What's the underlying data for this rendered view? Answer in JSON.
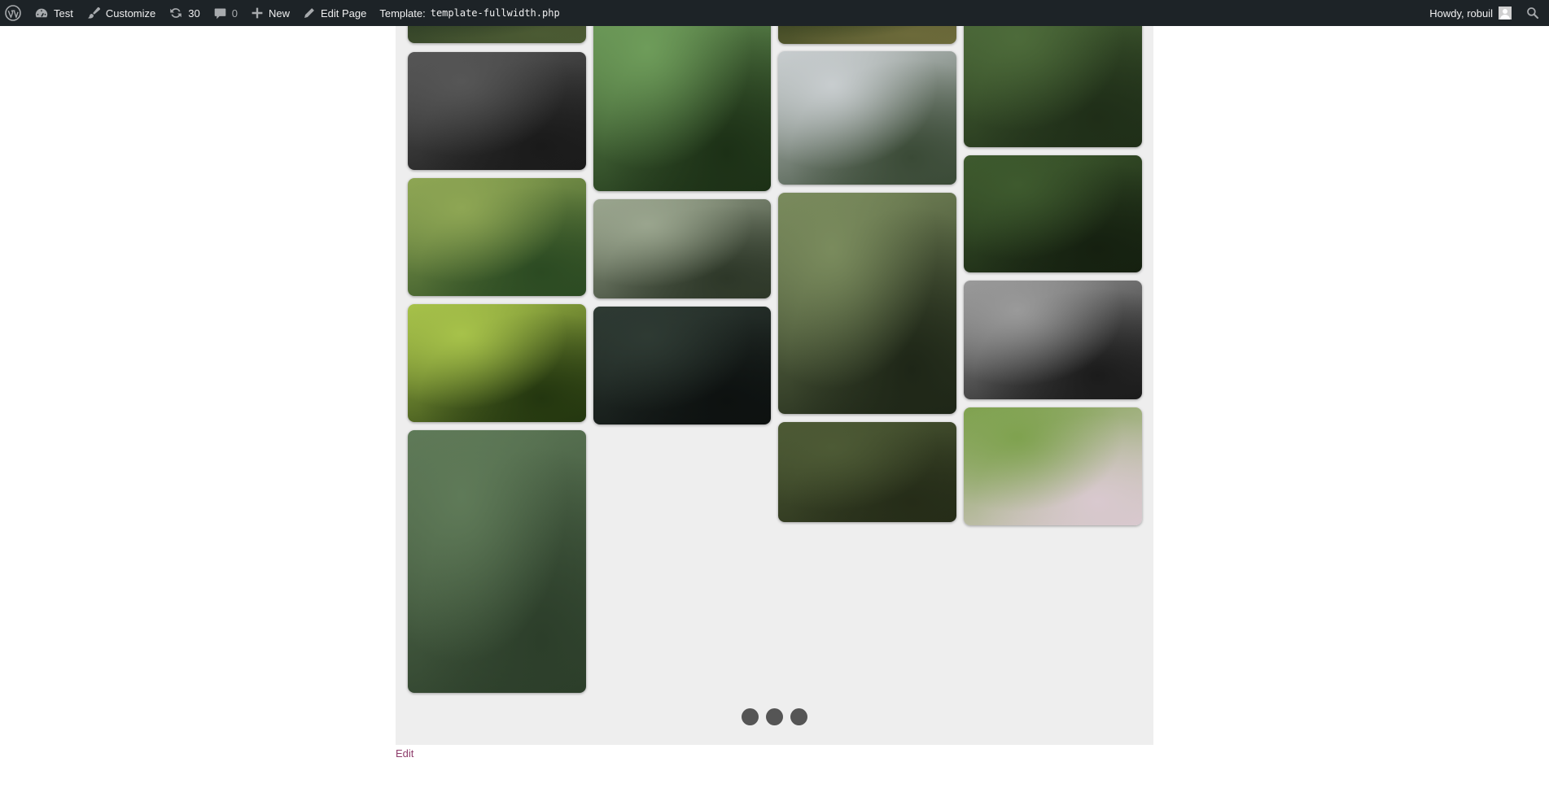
{
  "adminbar": {
    "site_name": "Test",
    "customize_label": "Customize",
    "updates_count": "30",
    "comments_count": "0",
    "new_label": "New",
    "edit_page_label": "Edit Page",
    "template_label": "Template:",
    "template_file": "template-fullwidth.php",
    "greeting": "Howdy, robuil"
  },
  "gallery": {
    "photos": [
      {
        "name": "photo-forest-top-strip-1",
        "colors": [
          "#2f3f26",
          "#4b5a33"
        ]
      },
      {
        "name": "photo-misty-dark-forest",
        "colors": [
          "#565656",
          "#1a1a1a"
        ]
      },
      {
        "name": "photo-tall-trees-green",
        "colors": [
          "#8ea654",
          "#2b4a22"
        ]
      },
      {
        "name": "photo-bright-canopy",
        "colors": [
          "#a7c24a",
          "#23360f"
        ]
      },
      {
        "name": "photo-hiker-on-trail",
        "colors": [
          "#5f7a58",
          "#2c3e2a"
        ]
      },
      {
        "name": "photo-forest-path",
        "colors": [
          "#6e9c5a",
          "#1c3016"
        ]
      },
      {
        "name": "photo-tree-canopy-sky",
        "colors": [
          "#9aa58e",
          "#2d3728"
        ]
      },
      {
        "name": "photo-dark-fern",
        "colors": [
          "#2e3a33",
          "#0d1110"
        ]
      },
      {
        "name": "photo-forest-top-strip-3",
        "colors": [
          "#3b4522",
          "#6c6a3a"
        ]
      },
      {
        "name": "photo-misty-valley",
        "colors": [
          "#c8cdcf",
          "#3a4a36"
        ]
      },
      {
        "name": "photo-person-in-jungle",
        "colors": [
          "#7a8b5d",
          "#1e2617"
        ]
      },
      {
        "name": "photo-waterfall-cliff",
        "colors": [
          "#4d5a35",
          "#252c18"
        ]
      },
      {
        "name": "photo-leafy-plants",
        "colors": [
          "#4d6b3a",
          "#1f2e18"
        ]
      },
      {
        "name": "photo-dark-undergrowth",
        "colors": [
          "#3e5a2e",
          "#152010"
        ]
      },
      {
        "name": "photo-bamboo-bw",
        "colors": [
          "#9a9a9a",
          "#1b1b1b"
        ]
      },
      {
        "name": "photo-palm-leaves",
        "colors": [
          "#7fa24f",
          "#d9c9cf"
        ]
      }
    ]
  },
  "pagination": {
    "dots": 3
  },
  "footer": {
    "edit_label": "Edit"
  }
}
